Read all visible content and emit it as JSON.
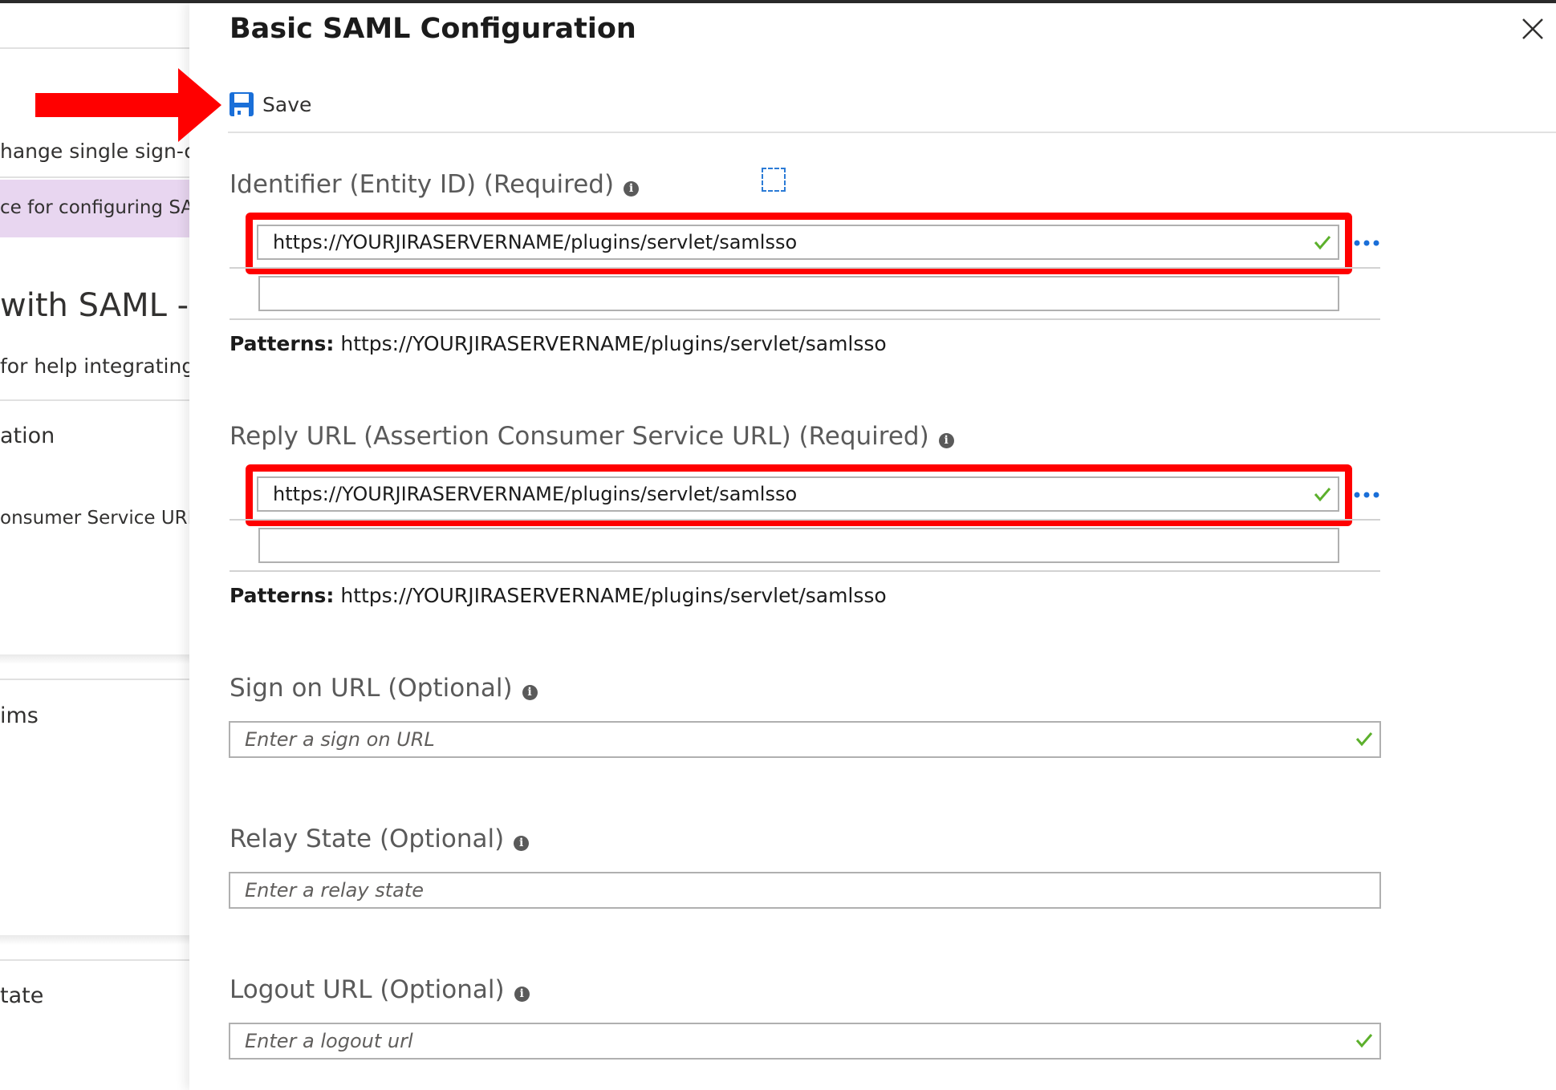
{
  "background_blade": {
    "items": [
      "hange single sign-on",
      "ce for configuring SAM",
      "with SAML - P",
      "for help integrating J",
      "ation",
      "onsumer Service URL",
      "ims",
      "tate"
    ]
  },
  "panel": {
    "title": "Basic SAML Configuration",
    "toolbar": {
      "save_label": "Save"
    },
    "identifier": {
      "label": "Identifier (Entity ID) (Required)",
      "value": "https://YOURJIRASERVERNAME/plugins/servlet/samlsso",
      "empty_value": "",
      "patterns_label": "Patterns:",
      "patterns_value": "https://YOURJIRASERVERNAME/plugins/servlet/samlsso"
    },
    "reply_url": {
      "label": "Reply URL (Assertion Consumer Service URL) (Required)",
      "value": "https://YOURJIRASERVERNAME/plugins/servlet/samlsso",
      "empty_value": "",
      "patterns_label": "Patterns:",
      "patterns_value": "https://YOURJIRASERVERNAME/plugins/servlet/samlsso"
    },
    "sign_on_url": {
      "label": "Sign on URL (Optional)",
      "placeholder": "Enter a sign on URL"
    },
    "relay_state": {
      "label": "Relay State (Optional)",
      "placeholder": "Enter a relay state"
    },
    "logout_url": {
      "label": "Logout URL (Optional)",
      "placeholder": "Enter a logout url"
    }
  },
  "colors": {
    "annotation_red": "#ff0000",
    "check_green": "#5cb02c",
    "accent_blue": "#2b7bd6"
  }
}
